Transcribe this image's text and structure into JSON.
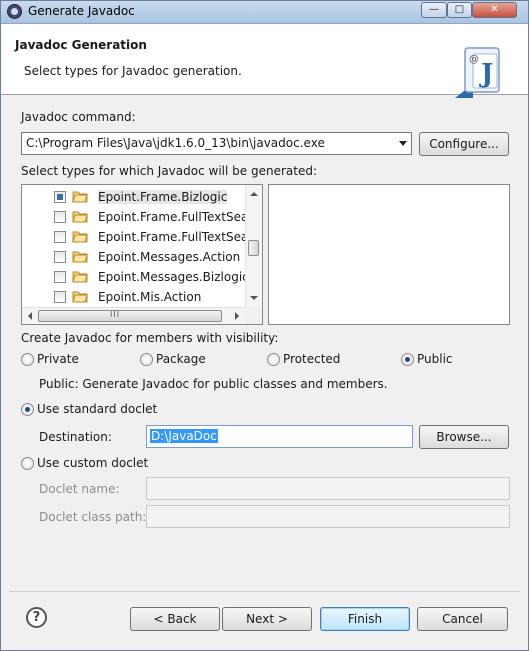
{
  "window": {
    "title": "Generate Javadoc",
    "controls": {
      "minimize": "—",
      "maximize": "□",
      "close": "✕"
    }
  },
  "header": {
    "title": "Javadoc Generation",
    "description": "Select types for Javadoc generation."
  },
  "javadoc_command": {
    "label": "Javadoc command:",
    "value": "C:\\Program Files\\Java\\jdk1.6.0_13\\bin\\javadoc.exe",
    "configure_button": "Configure..."
  },
  "types": {
    "label": "Select types for which Javadoc will be generated:",
    "items": [
      {
        "label": "Epoint.Frame.Bizlogic",
        "state": "partial",
        "selected": true
      },
      {
        "label": "Epoint.Frame.FullTextSear",
        "state": "unchecked",
        "selected": false
      },
      {
        "label": "Epoint.Frame.FullTextSear",
        "state": "unchecked",
        "selected": false
      },
      {
        "label": "Epoint.Messages.Action",
        "state": "unchecked",
        "selected": false
      },
      {
        "label": "Epoint.Messages.Bizlogic",
        "state": "unchecked",
        "selected": false
      },
      {
        "label": "Epoint.Mis.Action",
        "state": "unchecked",
        "selected": false
      }
    ],
    "hscroll_grip": "III"
  },
  "visibility": {
    "label": "Create Javadoc for members with visibility:",
    "options": [
      "Private",
      "Package",
      "Protected",
      "Public"
    ],
    "selected": "Public",
    "description": "Public: Generate Javadoc for public classes and members."
  },
  "standard_doclet": {
    "label": "Use standard doclet",
    "selected": true,
    "destination_label": "Destination:",
    "destination_value": "D:\\JavaDoc",
    "browse_button": "Browse..."
  },
  "custom_doclet": {
    "label": "Use custom doclet",
    "selected": false,
    "name_label": "Doclet name:",
    "classpath_label": "Doclet class path:"
  },
  "footer": {
    "help": "?",
    "back_button": "< Back",
    "next_button": "Next >",
    "finish_button": "Finish",
    "cancel_button": "Cancel"
  }
}
